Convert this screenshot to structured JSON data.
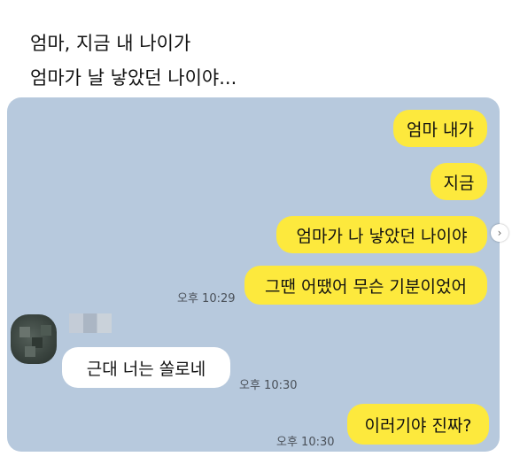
{
  "caption": {
    "line1": "엄마, 지금 내 나이가",
    "line2": "엄마가 날 낳았던 나이야..."
  },
  "chat": {
    "messages": [
      {
        "side": "me",
        "text": "엄마 내가"
      },
      {
        "side": "me",
        "text": "지금"
      },
      {
        "side": "me",
        "text": "엄마가 나 낳았던 나이야"
      },
      {
        "side": "me",
        "text": "그땐 어땠어 무슨 기분이었어",
        "time": "오후 10:29"
      },
      {
        "side": "other",
        "text": "근대 너는   쏠로네",
        "time": "오후 10:30"
      },
      {
        "side": "me",
        "text": "이러기야 진짜?",
        "time": "오후 10:30"
      }
    ]
  },
  "colors": {
    "chat_background": "#b7c9dd",
    "my_bubble": "#fde93d",
    "other_bubble": "#ffffff"
  },
  "icons": {
    "next": "chevron-right-icon"
  }
}
